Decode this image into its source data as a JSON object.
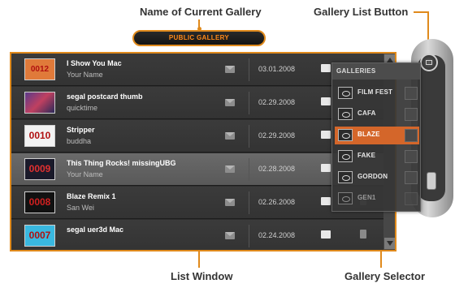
{
  "callouts": {
    "current_gallery": "Name of Current Gallery",
    "gallery_list_button": "Gallery List Button",
    "list_window": "List Window",
    "gallery_selector": "Gallery Selector"
  },
  "current_gallery": "PUBLIC GALLERY",
  "rows": [
    {
      "thumb": "0012",
      "title": "I Show You Mac",
      "subtitle": "Your Name",
      "date": "03.01.2008"
    },
    {
      "thumb": "",
      "title": "segal postcard thumb",
      "subtitle": "quicktime",
      "date": "02.29.2008"
    },
    {
      "thumb": "0010",
      "title": "Stripper",
      "subtitle": "buddha",
      "date": "02.29.2008"
    },
    {
      "thumb": "0009",
      "title": "This Thing Rocks! missingUBG",
      "subtitle": "Your Name",
      "date": "02.28.2008"
    },
    {
      "thumb": "0008",
      "title": "Blaze Remix 1",
      "subtitle": "San Wei",
      "date": "02.26.2008"
    },
    {
      "thumb": "0007",
      "title": "segal uer3d Mac",
      "subtitle": "",
      "date": "02.24.2008"
    }
  ],
  "galleries_panel": {
    "header": "GALLERIES",
    "items": [
      "FILM FEST",
      "CAFA",
      "BLAZE",
      "FAKE",
      "GORDON",
      "GEN1"
    ],
    "selected": "BLAZE"
  },
  "colors": {
    "accent": "#e08a1c",
    "selected_gallery": "#d4662a"
  },
  "icons": [
    "mail-icon",
    "folder-icon",
    "trash-icon",
    "eye-icon",
    "scroll-up-arrow-icon",
    "scroll-down-arrow-icon"
  ]
}
